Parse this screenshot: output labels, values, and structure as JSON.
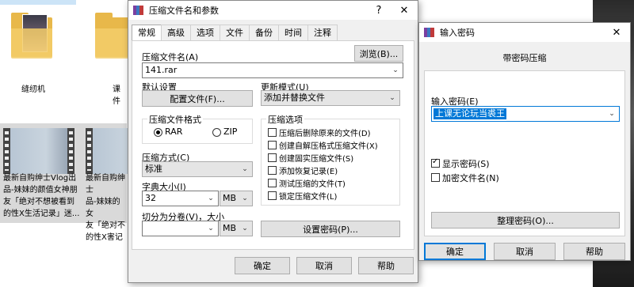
{
  "background": {
    "folders": [
      {
        "label": "缝纫机"
      },
      {
        "label": "课件"
      }
    ],
    "videos": [
      {
        "lines": [
          "最新自购绅士Vlog出",
          "品-妹妹的颜值女神朋",
          "友「绝对不想被看到",
          "的性X生活记录」迷..."
        ]
      },
      {
        "lines": [
          "最新自购绅士",
          "品-妹妹的女",
          "友「绝对不",
          "的性X害记"
        ]
      }
    ]
  },
  "main_dialog": {
    "title": "压缩文件名和参数",
    "help_glyph": "?",
    "close_glyph": "✕",
    "tabs": [
      "常规",
      "高级",
      "选项",
      "文件",
      "备份",
      "时间",
      "注释"
    ],
    "active_tab": "常规",
    "archive_name_label": "压缩文件名(A)",
    "browse_button": "浏览(B)...",
    "archive_name_value": "141.rar",
    "default_settings_label": "默认设置",
    "profiles_button": "配置文件(F)...",
    "update_mode_label": "更新模式(U)",
    "update_mode_value": "添加并替换文件",
    "format_group": "压缩文件格式",
    "format_options": [
      "RAR",
      "ZIP"
    ],
    "format_selected": "RAR",
    "method_label": "压缩方式(C)",
    "method_value": "标准",
    "dict_label": "字典大小(I)",
    "dict_value": "32",
    "dict_unit": "MB",
    "split_label": "切分为分卷(V)，大小",
    "split_value": "",
    "split_unit": "MB",
    "options_group": "压缩选项",
    "options": [
      {
        "label": "压缩后删除原来的文件(D)",
        "checked": false
      },
      {
        "label": "创建自解压格式压缩文件(X)",
        "checked": false
      },
      {
        "label": "创建固实压缩文件(S)",
        "checked": false
      },
      {
        "label": "添加恢复记录(E)",
        "checked": false
      },
      {
        "label": "测试压缩的文件(T)",
        "checked": false
      },
      {
        "label": "锁定压缩文件(L)",
        "checked": false
      }
    ],
    "set_password_button": "设置密码(P)...",
    "ok_button": "确定",
    "cancel_button": "取消",
    "help_button": "帮助"
  },
  "password_dialog": {
    "title": "输入密码",
    "close_glyph": "✕",
    "heading": "带密码压缩",
    "password_label": "输入密码(E)",
    "password_value": "上课无论玩当裘王",
    "show_password_label": "显示密码(S)",
    "show_password_checked": true,
    "encrypt_names_label": "加密文件名(N)",
    "encrypt_names_checked": false,
    "organize_button": "整理密码(O)...",
    "ok_button": "确定",
    "cancel_button": "取消",
    "help_button": "帮助"
  },
  "colors": {
    "accent": "#0078d7",
    "dialog_bg": "#f0f0f0",
    "button_bg": "#e1e1e1"
  }
}
